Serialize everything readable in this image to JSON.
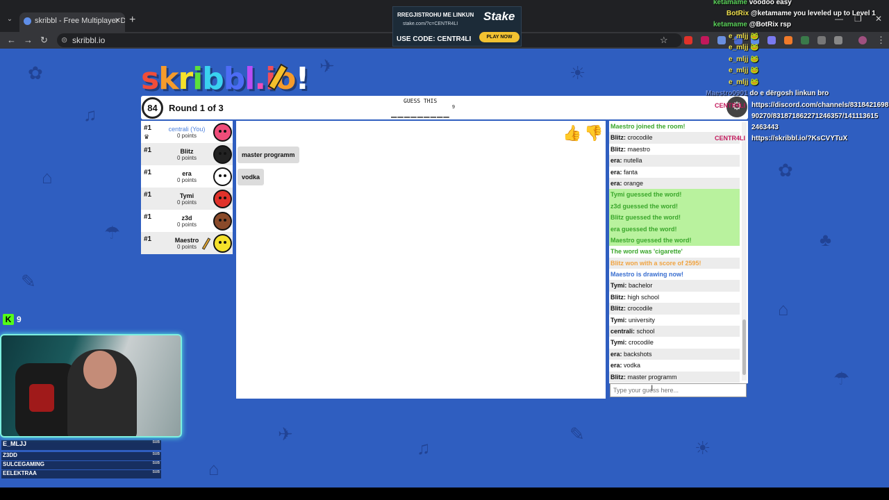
{
  "browser": {
    "tab_title": "skribbl - Free Multiplayer Drawi",
    "url": "skribbl.io"
  },
  "ad": {
    "line1": "RREGJISTROHU ME LINKUN",
    "url": "stake.com/?c=CENTR4LI",
    "code": "USE CODE: CENTR4LI",
    "brand": "Stake",
    "button": "PLAY NOW"
  },
  "game": {
    "logo": [
      "s",
      "k",
      "r",
      "i",
      "b",
      "b",
      "l",
      ".",
      "i",
      "o",
      "!"
    ],
    "timer": "84",
    "round": "Round 1 of 3",
    "guess_title": "GUESS THIS",
    "word_blank": "_________",
    "word_length": "9",
    "players": [
      {
        "rank": "#1",
        "name": "centrali (You)",
        "points": "0 points",
        "avatar_color": "#f04d7a",
        "you": true,
        "crown": true
      },
      {
        "rank": "#1",
        "name": "Blitz",
        "points": "0 points",
        "avatar_color": "#222222"
      },
      {
        "rank": "#1",
        "name": "era",
        "points": "0 points",
        "avatar_color": "#ffffff"
      },
      {
        "rank": "#1",
        "name": "Tymi",
        "points": "0 points",
        "avatar_color": "#e0322a"
      },
      {
        "rank": "#1",
        "name": "z3d",
        "points": "0 points",
        "avatar_color": "#8a4a2a"
      },
      {
        "rank": "#1",
        "name": "Maestro",
        "points": "0 points",
        "avatar_color": "#f5e12b",
        "drawing": true
      }
    ],
    "bubbles": [
      "master programm",
      "vodka"
    ],
    "chat": [
      {
        "text": "Maestro joined the room!",
        "style": "joined"
      },
      {
        "user": "Blitz:",
        "text": "crocodile"
      },
      {
        "user": "Blitz:",
        "text": "maestro"
      },
      {
        "user": "era:",
        "text": "nutella"
      },
      {
        "user": "era:",
        "text": "fanta"
      },
      {
        "user": "era:",
        "text": "orange"
      },
      {
        "text": "Tymi guessed the word!",
        "style": "green"
      },
      {
        "text": "z3d guessed the word!",
        "style": "green"
      },
      {
        "text": "Blitz guessed the word!",
        "style": "green"
      },
      {
        "text": "era guessed the word!",
        "style": "green"
      },
      {
        "text": "Maestro guessed the word!",
        "style": "green"
      },
      {
        "text": "The word was 'cigarette'",
        "style": "joined"
      },
      {
        "text": "Blitz won with a score of 2595!",
        "style": "orange"
      },
      {
        "text": "Maestro is drawing now!",
        "style": "blue"
      },
      {
        "user": "Tymi:",
        "text": "bachelor"
      },
      {
        "user": "Blitz:",
        "text": "high school"
      },
      {
        "user": "Blitz:",
        "text": "crocodile"
      },
      {
        "user": "Tymi:",
        "text": "university"
      },
      {
        "user": "centrali:",
        "text": "school"
      },
      {
        "user": "Tymi:",
        "text": "crocodile"
      },
      {
        "user": "era:",
        "text": "backshots"
      },
      {
        "user": "era:",
        "text": "vodka"
      },
      {
        "user": "Blitz:",
        "text": "master programm"
      }
    ],
    "chat_placeholder": "Type your guess here..."
  },
  "stream": {
    "chat": [
      {
        "user": "ketamame",
        "text": "voodoo easy"
      },
      {
        "user": "BotRix",
        "text": "@ketamame you leveled up to Level 1"
      },
      {
        "user": "ketamame",
        "text": "@BotRix rsp"
      },
      {
        "user": "e_mljj",
        "text": ""
      },
      {
        "user": "e_mljj",
        "text": ""
      },
      {
        "user": "e_mljj",
        "text": ""
      },
      {
        "user": "e_mljj",
        "text": ""
      },
      {
        "user": "e_mljj",
        "text": ""
      },
      {
        "user": "Maestro0901",
        "text": "do e dërgosh linkun bro"
      },
      {
        "user": "",
        "text": "https://discord.com/channels/8318421698"
      },
      {
        "user": "",
        "text": "90270/831871862271246357/141113615"
      },
      {
        "user": "",
        "text": "2463443"
      },
      {
        "user": "",
        "text": "https://skribbl.io/?KsCVYTuX"
      }
    ],
    "centr4li": "CENTR4LI",
    "kick_count": "9",
    "kick_letter": "K",
    "subs_title": "E_MLJJ",
    "subs": [
      "Z3DD",
      "SULCEGAMING",
      "EELEKTRAA"
    ],
    "sub_tag": "SUB"
  }
}
